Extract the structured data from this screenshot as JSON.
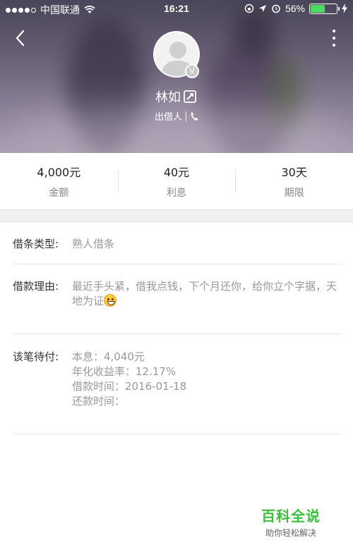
{
  "status_bar": {
    "carrier": "中国联通",
    "time": "16:21",
    "battery": "56%",
    "battery_level": 0.56
  },
  "header": {
    "name": "林如",
    "role": "出借人",
    "back_icon": "chevron-left-icon",
    "more_icon": "more-vertical-icon",
    "verified_badge": "V"
  },
  "stats": [
    {
      "value": "4,000元",
      "label": "金额"
    },
    {
      "value": "40元",
      "label": "利息"
    },
    {
      "value": "30天",
      "label": "期限"
    }
  ],
  "details": {
    "type_label": "借条类型:",
    "type_value": "熟人借条",
    "reason_label": "借款理由:",
    "reason_value": "最近手头紧，借我点钱，下个月还你，给你立个字据，天地为证",
    "pending_label": "该笔待付:",
    "principal": "本息：4,040元",
    "annual_rate": "年化收益率：12.17%",
    "borrow_time": "借款时间：2016-01-18",
    "repay_time": "还款时间："
  },
  "watermark": {
    "title": "百科全说",
    "subtitle": "助你轻松解决"
  },
  "colors": {
    "battery_green": "#4cd964",
    "watermark_green": "#3cbf3c",
    "muted_text": "#999999"
  }
}
